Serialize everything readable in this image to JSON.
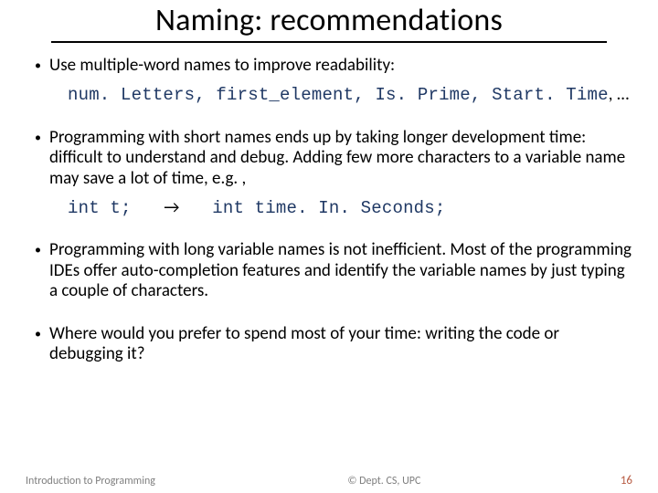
{
  "title": "Naming: recommendations",
  "bullets": {
    "b1": "Use multiple-word names to improve readability:",
    "b1_code": "num. Letters, first_element, Is. Prime, Start. Time",
    "b1_tail": ", …",
    "b2": "Programming with short names ends up by taking longer development time: difficult to understand and debug. Adding few more characters to a variable name may save a lot of time, e.g. ,",
    "b2_code_left": "int t;",
    "b2_arrow": "→",
    "b2_code_right": "int time. In. Seconds;",
    "b3": "Programming with long variable names is not inefficient. Most of the programming IDEs offer auto-completion features and identify the variable names by just typing a couple of characters.",
    "b4": "Where would you prefer to spend most of your time: writing the code or debugging it?"
  },
  "footer": {
    "left": "Introduction to Programming",
    "center": "© Dept. CS, UPC",
    "right": "16"
  }
}
